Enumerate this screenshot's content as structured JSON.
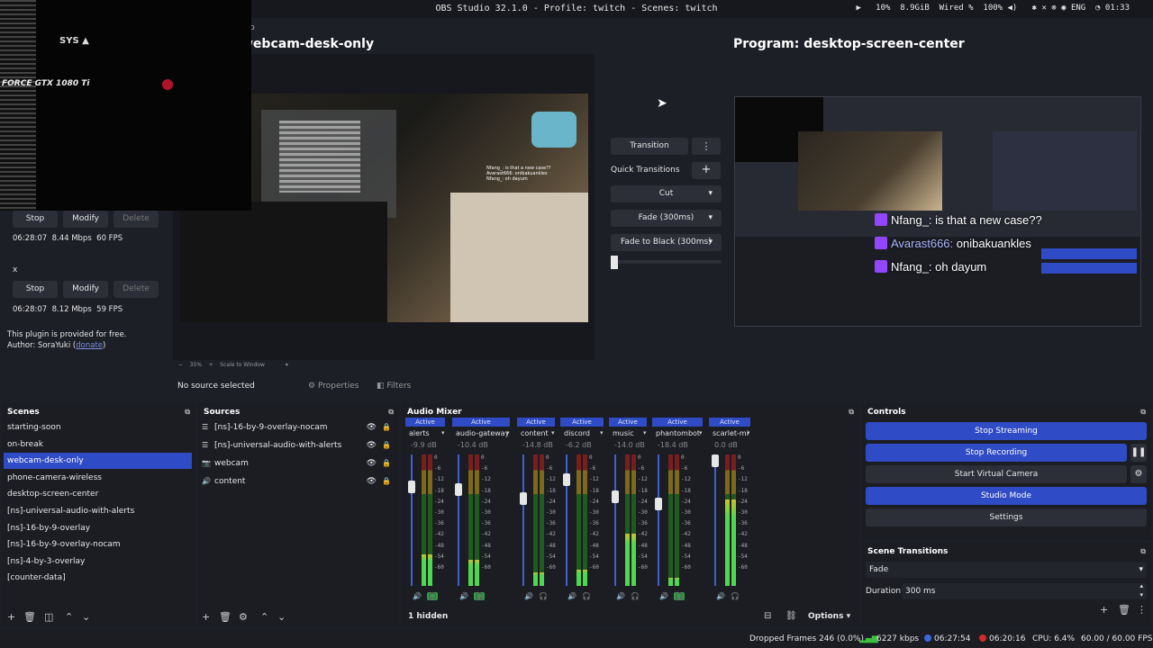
{
  "window": {
    "title": "OBS Studio 32.1.0 - Profile: twitch - Scenes: twitch"
  },
  "system_tray": {
    "play": "▶",
    "cpu": "10%",
    "memory": "8.9GiB",
    "network": "Wired",
    "battery": "100%",
    "keyboard_layout": "ENG",
    "clock": "01:33"
  },
  "preview": {
    "title": "webcam-desk-only",
    "zoom": "35%",
    "scale_mode": "Scale to Window"
  },
  "program": {
    "title": "Program: desktop-screen-center",
    "chat": [
      {
        "nick": "Nfang_:",
        "message": "is that a new case??"
      },
      {
        "nick": "Avarast666:",
        "message": "onibakuankles"
      },
      {
        "nick": "Nfang_:",
        "message": "oh dayum"
      }
    ]
  },
  "plugin_panel": {
    "output1": {
      "stop": "Stop",
      "modify": "Modify",
      "delete": "Delete",
      "stats": "06:28:07  8.44 Mbps  60 FPS"
    },
    "separator": "x",
    "output2": {
      "stop": "Stop",
      "modify": "Modify",
      "delete": "Delete",
      "stats": "06:28:07  8.12 Mbps  59 FPS"
    },
    "note": "This plugin is provided for free.",
    "author_prefix": "Author: SoraYuki (",
    "author_link": "donate",
    "author_suffix": ")"
  },
  "transitions": {
    "transition_button": "Transition",
    "quick_label": "Quick Transitions",
    "quick": [
      "Cut",
      "Fade (300ms)",
      "Fade to Black (300ms)"
    ]
  },
  "source_toolbar": {
    "no_source": "No source selected",
    "properties": "Properties",
    "filters": "Filters"
  },
  "scenes": {
    "title": "Scenes",
    "items": [
      "starting-soon",
      "on-break",
      "webcam-desk-only",
      "phone-camera-wireless",
      "desktop-screen-center",
      "[ns]-universal-audio-with-alerts",
      "[ns]-16-by-9-overlay",
      "[ns]-16-by-9-overlay-nocam",
      "[ns]-4-by-3-overlay",
      "[counter-data]"
    ],
    "selected": "webcam-desk-only"
  },
  "sources": {
    "title": "Sources",
    "items": [
      {
        "icon": "list",
        "label": "[ns]-16-by-9-overlay-nocam"
      },
      {
        "icon": "list",
        "label": "[ns]-universal-audio-with-alerts"
      },
      {
        "icon": "camera",
        "label": "webcam"
      },
      {
        "icon": "speaker",
        "label": "content"
      }
    ]
  },
  "audio_mixer": {
    "title": "Audio Mixer",
    "active_label": "Active",
    "ticks": [
      "0",
      "-6",
      "-12",
      "-18",
      "-24",
      "-30",
      "-36",
      "-42",
      "-48",
      "-54",
      "-60"
    ],
    "hidden": "1 hidden",
    "options": "Options",
    "channels": [
      {
        "name": "alerts",
        "db": "-9.9 dB",
        "level": 0.24,
        "fader": 0.78,
        "monitor_on": true
      },
      {
        "name": "audio-gateway-o",
        "db": "-10.4 dB",
        "level": 0.2,
        "fader": 0.76,
        "monitor_on": true
      },
      {
        "name": "content",
        "db": "-14.8 dB",
        "level": 0.1,
        "fader": 0.68,
        "monitor_on": false
      },
      {
        "name": "discord",
        "db": "-6.2 dB",
        "level": 0.12,
        "fader": 0.84,
        "monitor_on": false
      },
      {
        "name": "music",
        "db": "-14.0 dB",
        "level": 0.4,
        "fader": 0.7,
        "monitor_on": false
      },
      {
        "name": "phantombot",
        "db": "-18.4 dB",
        "level": 0.06,
        "fader": 0.64,
        "monitor_on": true
      },
      {
        "name": "scarlet-mic",
        "db": "0.0 dB",
        "level": 0.66,
        "fader": 1.0,
        "monitor_on": false
      }
    ]
  },
  "controls": {
    "title": "Controls",
    "stop_streaming": "Stop Streaming",
    "stop_recording": "Stop Recording",
    "start_virtual_camera": "Start Virtual Camera",
    "studio_mode": "Studio Mode",
    "settings": "Settings"
  },
  "scene_transitions": {
    "title": "Scene Transitions",
    "type": "Fade",
    "duration_label": "Duration",
    "duration_value": "300 ms"
  },
  "statusbar": {
    "dropped": "Dropped Frames 246 (0.0%)",
    "bitrate": "6227 kbps",
    "stream_time": "06:27:54",
    "rec_time": "06:20:16",
    "cpu": "CPU: 6.4%",
    "fps": "60.00 / 60.00 FPS"
  },
  "colors": {
    "accent": "#2f4bc5",
    "background": "#1d1f26",
    "recording": "#d02a2a",
    "monitor_on": "#2ea043"
  }
}
